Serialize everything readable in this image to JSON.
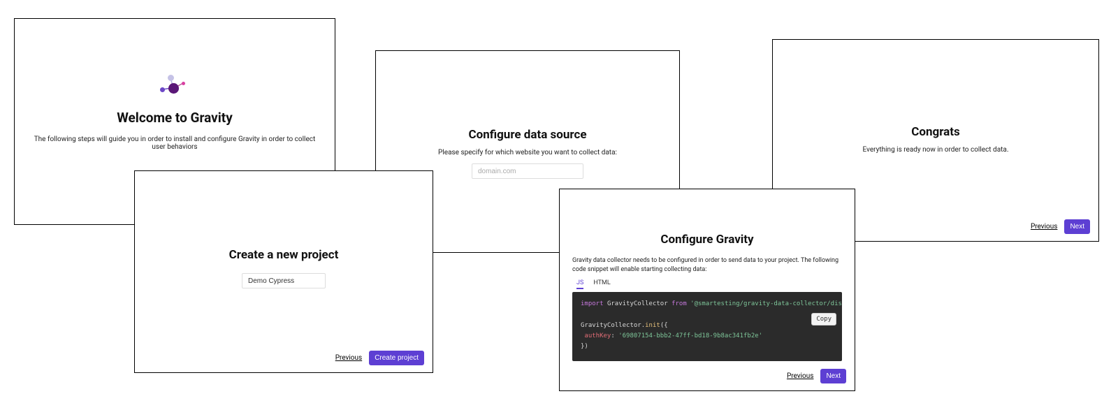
{
  "welcome": {
    "title": "Welcome to Gravity",
    "subtitle": "The following steps will guide you in order to install and configure Gravity in order to collect user behaviors"
  },
  "create_project": {
    "title": "Create a new project",
    "input_value": "Demo Cypress",
    "prev": "Previous",
    "submit": "Create project"
  },
  "data_source": {
    "title": "Configure data source",
    "subtitle": "Please specify for which website you want to collect data:",
    "placeholder": "domain.com"
  },
  "configure": {
    "title": "Configure Gravity",
    "desc": "Gravity data collector needs to be configured in order to send data to your project. The following code snippet will enable starting collecting data:",
    "tabs": {
      "js": "JS",
      "html": "HTML"
    },
    "code": {
      "kw_import": "import",
      "ident": "GravityCollector",
      "kw_from": "from",
      "pkg": "'@smartesting/gravity-data-collector/dist'",
      "line2_a": "GravityCollector.",
      "line2_b": "init",
      "line2_c": "({",
      "prop": "authKey",
      "prop_sep": ": ",
      "key": "'69807154-bbb2-47ff-bd18-9b8ac341fb2e'",
      "close": "})"
    },
    "copy": "Copy",
    "prev": "Previous",
    "next": "Next"
  },
  "congrats": {
    "title": "Congrats",
    "subtitle": "Everything is ready now in order to collect data.",
    "prev": "Previous",
    "next": "Next"
  }
}
